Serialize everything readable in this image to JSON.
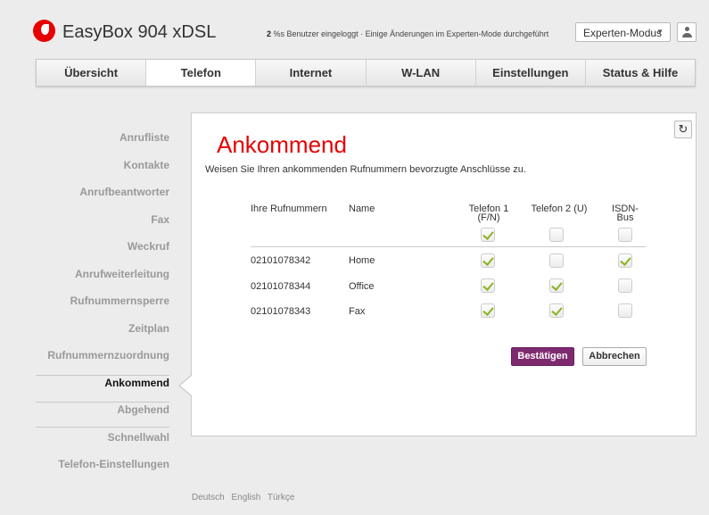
{
  "header": {
    "brand": "EasyBox 904 xDSL",
    "status_count": "2",
    "status_rest": " %s Benutzer eingeloggt · Einige Änderungen im Experten-Mode durchgeführt",
    "mode_select": "Experten-Modus",
    "colors": {
      "brand_red": "#e60000",
      "accent_purple": "#7d2a6f"
    }
  },
  "tabs": [
    {
      "label": "Übersicht"
    },
    {
      "label": "Telefon",
      "active": true
    },
    {
      "label": "Internet"
    },
    {
      "label": "W-LAN"
    },
    {
      "label": "Einstellungen"
    },
    {
      "label": "Status & Hilfe"
    }
  ],
  "sidebar": {
    "items": [
      {
        "label": "Anrufliste"
      },
      {
        "label": "Kontakte"
      },
      {
        "label": "Anrufbeantworter"
      },
      {
        "label": "Fax"
      },
      {
        "label": "Weckruf"
      },
      {
        "label": "Anrufweiterleitung"
      },
      {
        "label": "Rufnummernsperre"
      },
      {
        "label": "Zeitplan"
      },
      {
        "label": "Rufnummernzuordnung"
      },
      {
        "label": "Ankommend",
        "active": true
      },
      {
        "label": "Abgehend"
      },
      {
        "label": "Schnellwahl"
      },
      {
        "label": "Telefon-Einstellungen"
      }
    ]
  },
  "main": {
    "reset_icon": "refresh-icon",
    "title": "Ankommend",
    "description": "Weisen Sie Ihren ankommenden Rufnummern bevorzugte Anschlüsse zu.",
    "columns": {
      "number": "Ihre Rufnummern",
      "name": "Name",
      "phone1_a": "Telefon 1",
      "phone1_b": "(F/N)",
      "phone2": "Telefon 2 (U)",
      "isdn_a": "ISDN-",
      "isdn_b": "Bus"
    },
    "header_checks": [
      true,
      false,
      false
    ],
    "rows": [
      {
        "number": "02101078342",
        "name": "Home",
        "checks": [
          true,
          false,
          true
        ]
      },
      {
        "number": "02101078344",
        "name": "Office",
        "checks": [
          true,
          true,
          false
        ]
      },
      {
        "number": "02101078343",
        "name": "Fax",
        "checks": [
          true,
          true,
          false
        ]
      }
    ],
    "confirm_label": "Bestätigen",
    "cancel_label": "Abbrechen"
  },
  "footer": {
    "languages": [
      "Deutsch",
      "English",
      "Türkçe"
    ]
  }
}
